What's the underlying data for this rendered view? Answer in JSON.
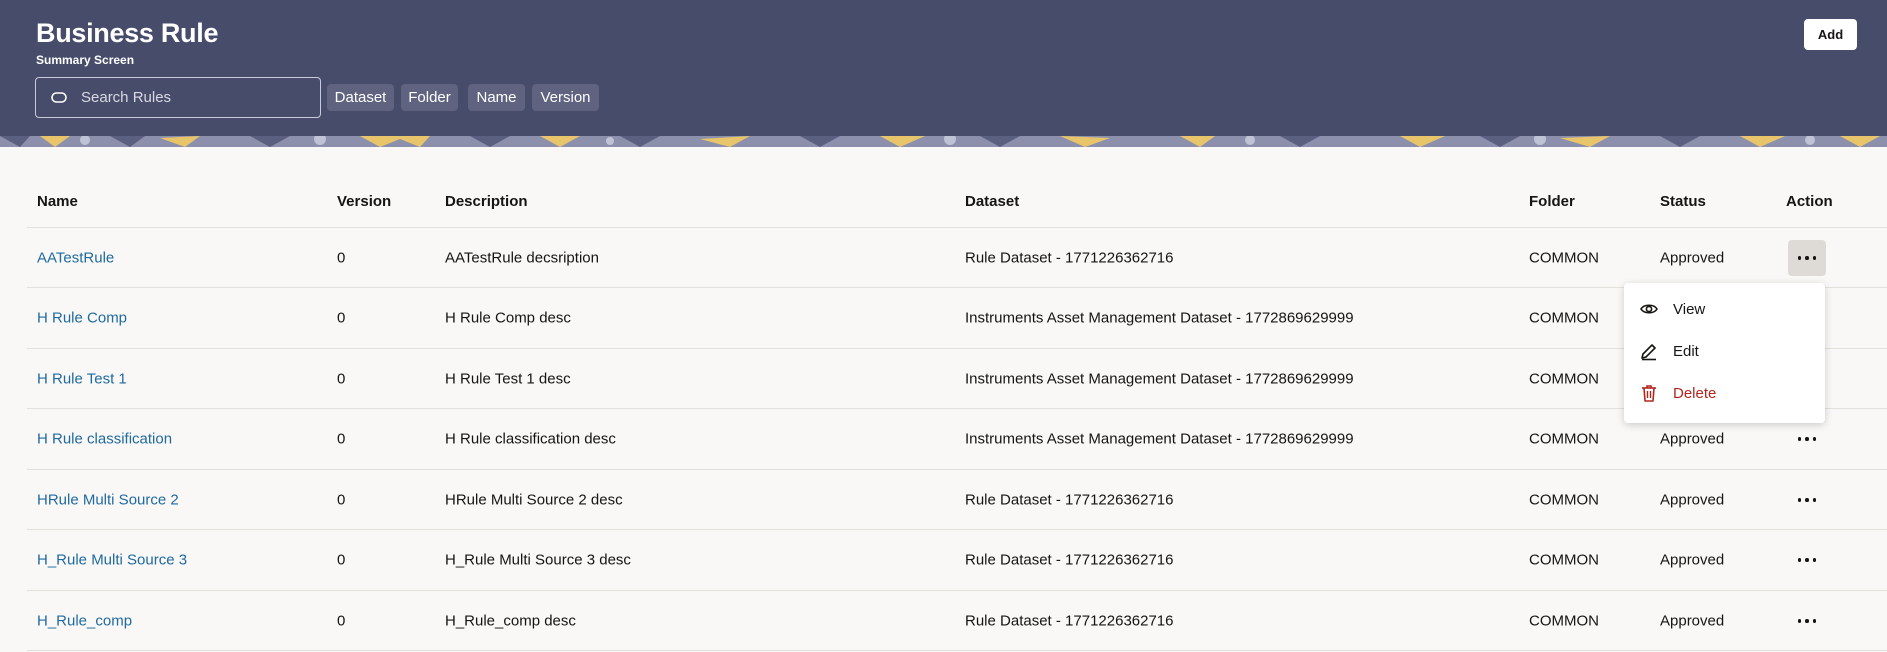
{
  "header": {
    "title": "Business Rule",
    "subtitle": "Summary Screen",
    "add_label": "Add",
    "search_placeholder": "Search Rules",
    "filters": [
      "Dataset",
      "Folder",
      "Name",
      "Version"
    ]
  },
  "table": {
    "columns": [
      "Name",
      "Version",
      "Description",
      "Dataset",
      "Folder",
      "Status",
      "Action"
    ],
    "rows": [
      {
        "name": "AATestRule",
        "version": "0",
        "description": "AATestRule decsription",
        "dataset": "Rule Dataset - 1771226362716",
        "folder": "COMMON",
        "status": "Approved"
      },
      {
        "name": "H Rule Comp",
        "version": "0",
        "description": "H Rule Comp desc",
        "dataset": "Instruments Asset Management Dataset - 1772869629999",
        "folder": "COMMON",
        "status": ""
      },
      {
        "name": "H Rule Test 1",
        "version": "0",
        "description": "H Rule Test 1 desc",
        "dataset": "Instruments Asset Management Dataset - 1772869629999",
        "folder": "COMMON",
        "status": ""
      },
      {
        "name": "H Rule classification",
        "version": "0",
        "description": "H Rule classification desc",
        "dataset": "Instruments Asset Management Dataset - 1772869629999",
        "folder": "COMMON",
        "status": "Approved"
      },
      {
        "name": "HRule Multi Source 2",
        "version": "0",
        "description": "HRule Multi Source 2 desc",
        "dataset": "Rule Dataset - 1771226362716",
        "folder": "COMMON",
        "status": "Approved"
      },
      {
        "name": "H_Rule Multi Source 3",
        "version": "0",
        "description": "H_Rule Multi Source 3 desc",
        "dataset": "Rule Dataset - 1771226362716",
        "folder": "COMMON",
        "status": "Approved"
      },
      {
        "name": "H_Rule_comp",
        "version": "0",
        "description": "H_Rule_comp desc",
        "dataset": "Rule Dataset - 1771226362716",
        "folder": "COMMON",
        "status": "Approved"
      }
    ]
  },
  "action_menu": {
    "items": [
      {
        "label": "View",
        "icon": "eye-icon"
      },
      {
        "label": "Edit",
        "icon": "pencil-icon"
      },
      {
        "label": "Delete",
        "icon": "trash-icon"
      }
    ]
  },
  "colors": {
    "header_bg": "#474c6a",
    "chip_bg": "#5f6380",
    "link": "#1f6aa0",
    "danger": "#b3261e",
    "page_bg": "#f9f8f6"
  }
}
